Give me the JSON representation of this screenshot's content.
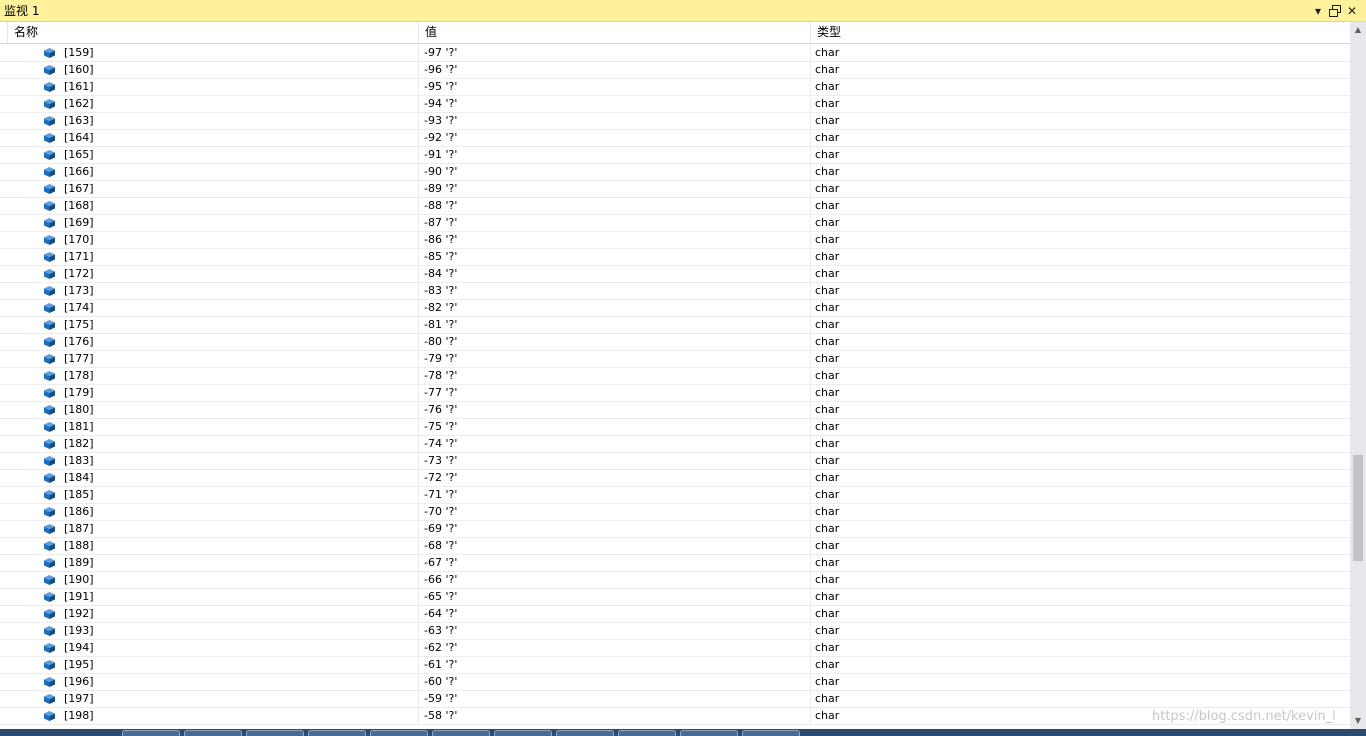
{
  "window": {
    "title": "监视 1",
    "dropdown_icon": "dropdown-arrow-icon",
    "restore_icon": "restore-window-icon",
    "close_icon": "close-icon"
  },
  "columns": {
    "name": "名称",
    "value": "值",
    "type": "类型"
  },
  "rows": [
    {
      "name": "[159]",
      "value": "-97 '?'",
      "type": "char"
    },
    {
      "name": "[160]",
      "value": "-96 '?'",
      "type": "char"
    },
    {
      "name": "[161]",
      "value": "-95 '?'",
      "type": "char"
    },
    {
      "name": "[162]",
      "value": "-94 '?'",
      "type": "char"
    },
    {
      "name": "[163]",
      "value": "-93 '?'",
      "type": "char"
    },
    {
      "name": "[164]",
      "value": "-92 '?'",
      "type": "char"
    },
    {
      "name": "[165]",
      "value": "-91 '?'",
      "type": "char"
    },
    {
      "name": "[166]",
      "value": "-90 '?'",
      "type": "char"
    },
    {
      "name": "[167]",
      "value": "-89 '?'",
      "type": "char"
    },
    {
      "name": "[168]",
      "value": "-88 '?'",
      "type": "char"
    },
    {
      "name": "[169]",
      "value": "-87 '?'",
      "type": "char"
    },
    {
      "name": "[170]",
      "value": "-86 '?'",
      "type": "char"
    },
    {
      "name": "[171]",
      "value": "-85 '?'",
      "type": "char"
    },
    {
      "name": "[172]",
      "value": "-84 '?'",
      "type": "char"
    },
    {
      "name": "[173]",
      "value": "-83 '?'",
      "type": "char"
    },
    {
      "name": "[174]",
      "value": "-82 '?'",
      "type": "char"
    },
    {
      "name": "[175]",
      "value": "-81 '?'",
      "type": "char"
    },
    {
      "name": "[176]",
      "value": "-80 '?'",
      "type": "char"
    },
    {
      "name": "[177]",
      "value": "-79 '?'",
      "type": "char"
    },
    {
      "name": "[178]",
      "value": "-78 '?'",
      "type": "char"
    },
    {
      "name": "[179]",
      "value": "-77 '?'",
      "type": "char"
    },
    {
      "name": "[180]",
      "value": "-76 '?'",
      "type": "char"
    },
    {
      "name": "[181]",
      "value": "-75 '?'",
      "type": "char"
    },
    {
      "name": "[182]",
      "value": "-74 '?'",
      "type": "char"
    },
    {
      "name": "[183]",
      "value": "-73 '?'",
      "type": "char"
    },
    {
      "name": "[184]",
      "value": "-72 '?'",
      "type": "char"
    },
    {
      "name": "[185]",
      "value": "-71 '?'",
      "type": "char"
    },
    {
      "name": "[186]",
      "value": "-70 '?'",
      "type": "char"
    },
    {
      "name": "[187]",
      "value": "-69 '?'",
      "type": "char"
    },
    {
      "name": "[188]",
      "value": "-68 '?'",
      "type": "char"
    },
    {
      "name": "[189]",
      "value": "-67 '?'",
      "type": "char"
    },
    {
      "name": "[190]",
      "value": "-66 '?'",
      "type": "char"
    },
    {
      "name": "[191]",
      "value": "-65 '?'",
      "type": "char"
    },
    {
      "name": "[192]",
      "value": "-64 '?'",
      "type": "char"
    },
    {
      "name": "[193]",
      "value": "-63 '?'",
      "type": "char"
    },
    {
      "name": "[194]",
      "value": "-62 '?'",
      "type": "char"
    },
    {
      "name": "[195]",
      "value": "-61 '?'",
      "type": "char"
    },
    {
      "name": "[196]",
      "value": "-60 '?'",
      "type": "char"
    },
    {
      "name": "[197]",
      "value": "-59 '?'",
      "type": "char"
    },
    {
      "name": "[198]",
      "value": "-58 '?'",
      "type": "char"
    }
  ],
  "row_icon": "field-cube-icon",
  "watermark": "https://blog.csdn.net/kevin_l",
  "colors": {
    "titlebar": "#fff29d",
    "icon_blue": "#1f6fbf"
  }
}
